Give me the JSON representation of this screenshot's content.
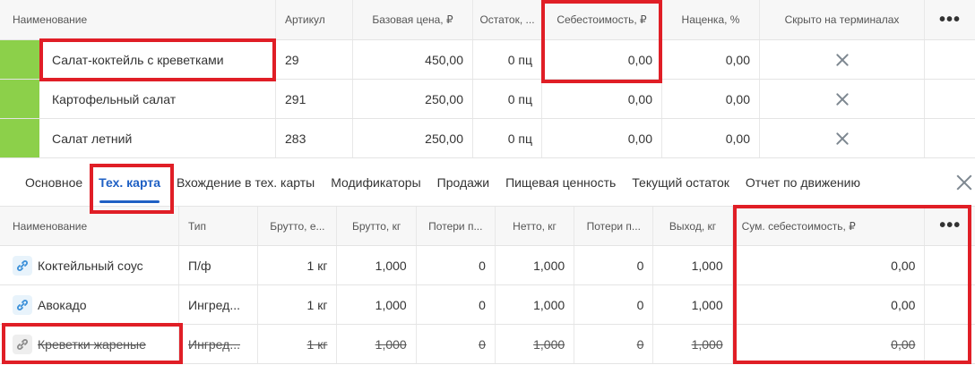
{
  "top_table": {
    "columns": [
      "Наименование",
      "Артикул",
      "Базовая цена, ₽",
      "Остаток, ...",
      "Себестоимость, ₽",
      "Наценка, %",
      "Скрыто на терминалах"
    ],
    "more_icon": "•••",
    "rows": [
      {
        "name": "Салат-коктейль с креветками",
        "article": "29",
        "base_price": "450,00",
        "stock": "0 пц",
        "cost": "0,00",
        "markup": "0,00"
      },
      {
        "name": "Картофельный салат",
        "article": "291",
        "base_price": "250,00",
        "stock": "0 пц",
        "cost": "0,00",
        "markup": "0,00"
      },
      {
        "name": "Салат летний",
        "article": "283",
        "base_price": "250,00",
        "stock": "0 пц",
        "cost": "0,00",
        "markup": "0,00"
      }
    ],
    "stripe_color": "#8cd04a"
  },
  "tabs": {
    "items": [
      "Основное",
      "Тех. карта",
      "Вхождение в тех. карты",
      "Модификаторы",
      "Продажи",
      "Пищевая ценность",
      "Текущий остаток",
      "Отчет по движению"
    ],
    "active": "Тех. карта",
    "accent": "#1f60c4"
  },
  "bottom_table": {
    "columns": [
      "Наименование",
      "Тип",
      "Брутто, е...",
      "Брутто, кг",
      "Потери п...",
      "Нетто, кг",
      "Потери п...",
      "Выход, кг",
      "Сум. себестоимость, ₽"
    ],
    "more_icon": "•••",
    "rows": [
      {
        "name": "Коктейльный соус",
        "type": "П/ф",
        "gross_unit": "1 кг",
        "gross_kg": "1,000",
        "loss1": "0",
        "net_kg": "1,000",
        "loss2": "0",
        "output_kg": "1,000",
        "sum_cost": "0,00"
      },
      {
        "name": "Авокадо",
        "type": "Ингред...",
        "gross_unit": "1 кг",
        "gross_kg": "1,000",
        "loss1": "0",
        "net_kg": "1,000",
        "loss2": "0",
        "output_kg": "1,000",
        "sum_cost": "0,00"
      },
      {
        "name": "Креветки жареные",
        "type": "Ингред...",
        "gross_unit": "1 кг",
        "gross_kg": "1,000",
        "loss1": "0",
        "net_kg": "1,000",
        "loss2": "0",
        "output_kg": "1,000",
        "sum_cost": "0,00"
      }
    ]
  },
  "annotation_color": "#e01e26"
}
